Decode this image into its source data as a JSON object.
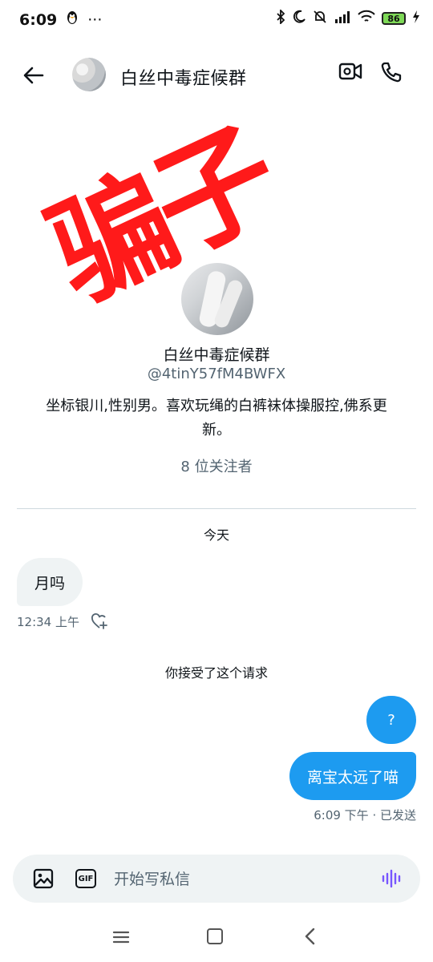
{
  "status_bar": {
    "time": "6:09",
    "more": "···",
    "battery": "86"
  },
  "header": {
    "title": "白丝中毒症候群"
  },
  "profile": {
    "stamp_text": "骗子",
    "name": "白丝中毒症候群",
    "handle": "@4tinY57fM4BWFX",
    "bio": "坐标银川,性别男。喜欢玩绳的白裤袜体操服控,佛系更新。",
    "followers": "8 位关注者"
  },
  "conversation": {
    "date_label": "今天",
    "incoming": {
      "text": "月吗",
      "time": "12:34 上午"
    },
    "accept_note": "你接受了这个请求",
    "outgoing": [
      {
        "text": "?"
      },
      {
        "text": "离宝太远了喵"
      }
    ],
    "outgoing_meta": "6:09 下午 · 已发送"
  },
  "composer": {
    "placeholder": "开始写私信",
    "gif_label": "GIF"
  },
  "colors": {
    "accent": "#1d9bf0",
    "stamp_red": "#ff1a1a",
    "bubble_in_bg": "#eff3f4",
    "muted_text": "#536471"
  }
}
